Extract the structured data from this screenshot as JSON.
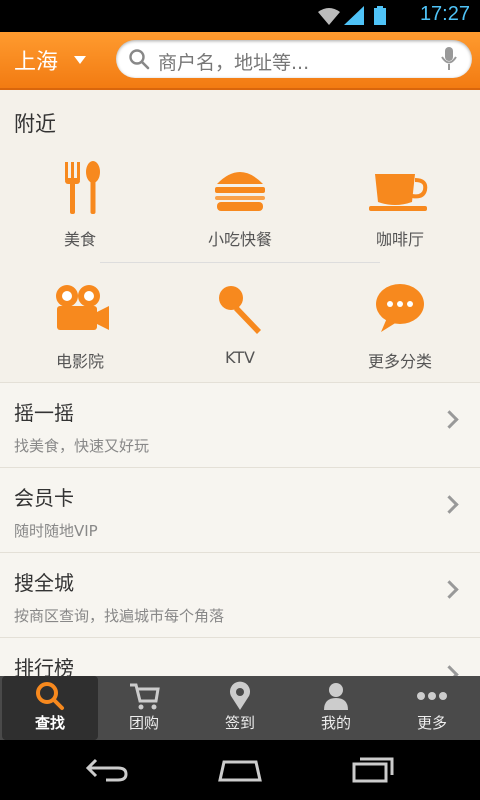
{
  "status": {
    "time": "17:27"
  },
  "header": {
    "city": "上海",
    "search_placeholder": "商户名，地址等..."
  },
  "nearby": {
    "title": "附近",
    "categories": [
      {
        "label": "美食",
        "icon": "fork-spoon-icon"
      },
      {
        "label": "小吃快餐",
        "icon": "burger-icon"
      },
      {
        "label": "咖啡厅",
        "icon": "coffee-cup-icon"
      },
      {
        "label": "电影院",
        "icon": "movie-camera-icon"
      },
      {
        "label": "KTV",
        "icon": "microphone-icon"
      },
      {
        "label": "更多分类",
        "icon": "more-bubble-icon"
      }
    ]
  },
  "list": [
    {
      "title": "摇一摇",
      "subtitle": "找美食，快速又好玩"
    },
    {
      "title": "会员卡",
      "subtitle": "随时随地VIP"
    },
    {
      "title": "搜全城",
      "subtitle": "按商区查询，找遍城市每个角落"
    },
    {
      "title": "排行榜",
      "subtitle": ""
    }
  ],
  "tabs": [
    {
      "label": "查找",
      "icon": "search-icon",
      "active": true
    },
    {
      "label": "团购",
      "icon": "cart-icon"
    },
    {
      "label": "签到",
      "icon": "location-pin-icon"
    },
    {
      "label": "我的",
      "icon": "person-icon"
    },
    {
      "label": "更多",
      "icon": "more-dots-icon"
    }
  ],
  "colors": {
    "accent": "#f7891e",
    "header": "#f27b12",
    "status_time": "#4fc3f7"
  }
}
